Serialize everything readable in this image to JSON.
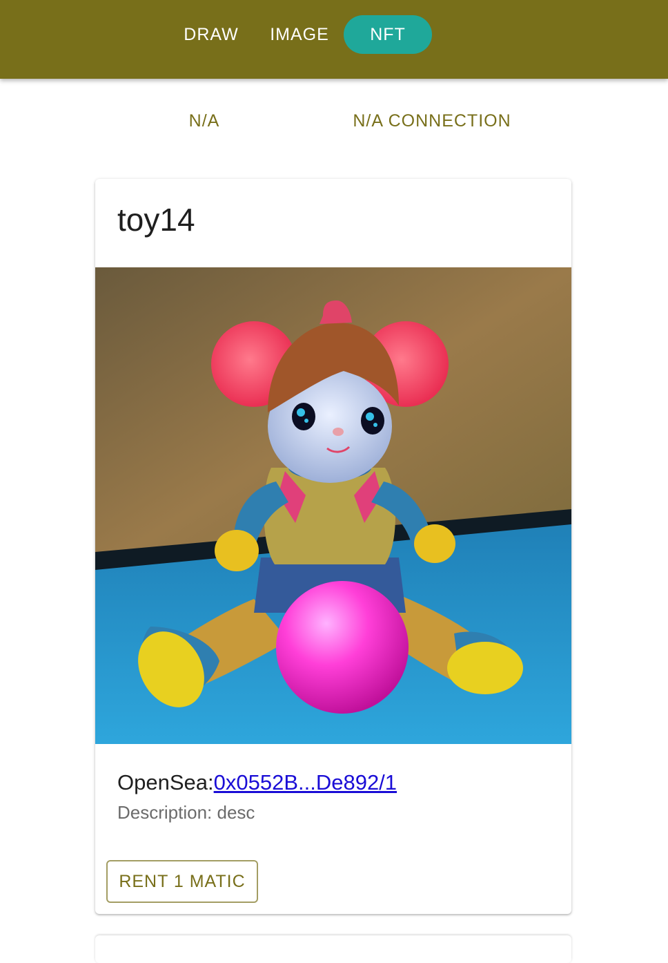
{
  "nav": {
    "draw": "DRAW",
    "image": "IMAGE",
    "nft": "NFT",
    "active_color": "#1fa89a",
    "bar_color": "#786f1a"
  },
  "status": {
    "network": "N/A",
    "connection": "N/A CONNECTION"
  },
  "nft_card": {
    "title": "toy14",
    "opensea_label": "OpenSea:",
    "opensea_link": "0x0552B...De892/1",
    "description": "Description: desc",
    "rent_label": "RENT 1 MATIC"
  }
}
